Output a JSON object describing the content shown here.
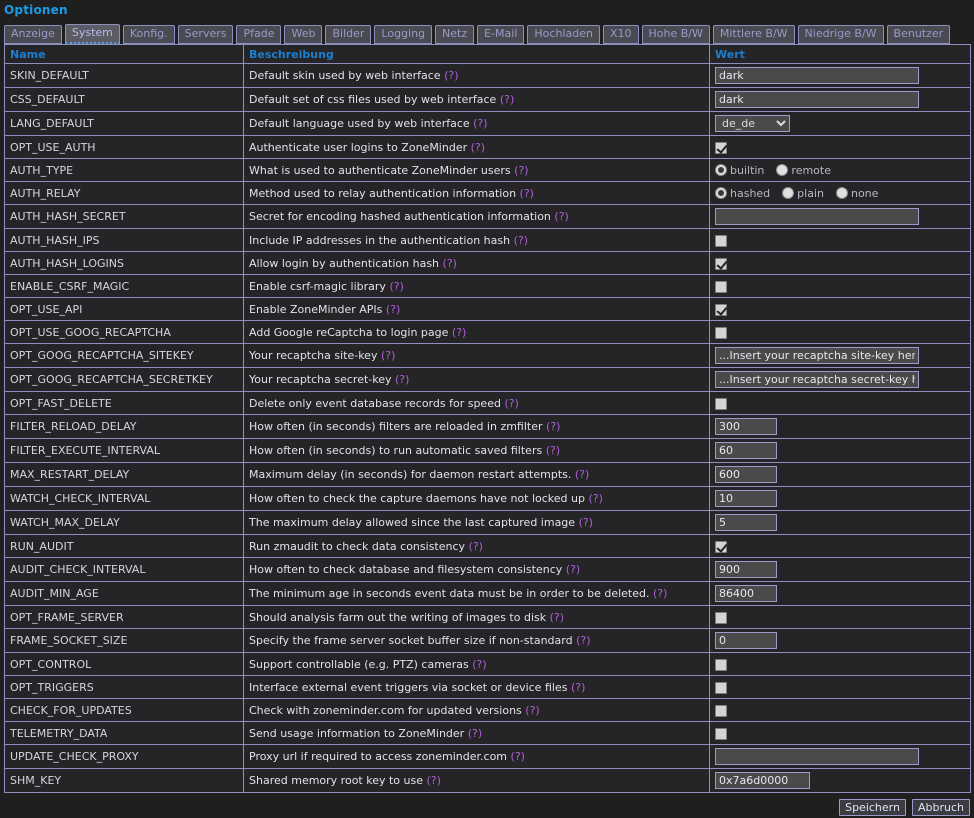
{
  "page": {
    "title": "Optionen"
  },
  "tabs": [
    {
      "label": "Anzeige",
      "active": false
    },
    {
      "label": "System",
      "active": true
    },
    {
      "label": "Konfig.",
      "active": false
    },
    {
      "label": "Servers",
      "active": false
    },
    {
      "label": "Pfade",
      "active": false
    },
    {
      "label": "Web",
      "active": false
    },
    {
      "label": "Bilder",
      "active": false
    },
    {
      "label": "Logging",
      "active": false
    },
    {
      "label": "Netz",
      "active": false
    },
    {
      "label": "E-Mail",
      "active": false
    },
    {
      "label": "Hochladen",
      "active": false
    },
    {
      "label": "X10",
      "active": false
    },
    {
      "label": "Hohe B/W",
      "active": false
    },
    {
      "label": "Mittlere B/W",
      "active": false
    },
    {
      "label": "Niedrige B/W",
      "active": false
    },
    {
      "label": "Benutzer",
      "active": false
    }
  ],
  "table": {
    "headers": {
      "name": "Name",
      "description": "Beschreibung",
      "value": "Wert"
    },
    "help_marker": "(?)",
    "rows": [
      {
        "name": "SKIN_DEFAULT",
        "desc": "Default skin used by web interface",
        "type": "text",
        "value": "dark",
        "width": "wide"
      },
      {
        "name": "CSS_DEFAULT",
        "desc": "Default set of css files used by web interface",
        "type": "text",
        "value": "dark",
        "width": "wide"
      },
      {
        "name": "LANG_DEFAULT",
        "desc": "Default language used by web interface",
        "type": "select",
        "value": "de_de",
        "options": [
          "de_de"
        ]
      },
      {
        "name": "OPT_USE_AUTH",
        "desc": "Authenticate user logins to ZoneMinder",
        "type": "checkbox",
        "checked": true
      },
      {
        "name": "AUTH_TYPE",
        "desc": "What is used to authenticate ZoneMinder users",
        "type": "radio",
        "selected": "builtin",
        "options": [
          "builtin",
          "remote"
        ]
      },
      {
        "name": "AUTH_RELAY",
        "desc": "Method used to relay authentication information",
        "type": "radio",
        "selected": "hashed",
        "options": [
          "hashed",
          "plain",
          "none"
        ]
      },
      {
        "name": "AUTH_HASH_SECRET",
        "desc": "Secret for encoding hashed authentication information",
        "type": "text",
        "value": "",
        "width": "wide"
      },
      {
        "name": "AUTH_HASH_IPS",
        "desc": "Include IP addresses in the authentication hash",
        "type": "checkbox",
        "checked": false
      },
      {
        "name": "AUTH_HASH_LOGINS",
        "desc": "Allow login by authentication hash",
        "type": "checkbox",
        "checked": true
      },
      {
        "name": "ENABLE_CSRF_MAGIC",
        "desc": "Enable csrf-magic library",
        "type": "checkbox",
        "checked": false
      },
      {
        "name": "OPT_USE_API",
        "desc": "Enable ZoneMinder APIs",
        "type": "checkbox",
        "checked": true
      },
      {
        "name": "OPT_USE_GOOG_RECAPTCHA",
        "desc": "Add Google reCaptcha to login page",
        "type": "checkbox",
        "checked": false
      },
      {
        "name": "OPT_GOOG_RECAPTCHA_SITEKEY",
        "desc": "Your recaptcha site-key",
        "type": "text",
        "value": "...Insert your recaptcha site-key here...",
        "width": "wide"
      },
      {
        "name": "OPT_GOOG_RECAPTCHA_SECRETKEY",
        "desc": "Your recaptcha secret-key",
        "type": "text",
        "value": "...Insert your recaptcha secret-key here...",
        "width": "wide"
      },
      {
        "name": "OPT_FAST_DELETE",
        "desc": "Delete only event database records for speed",
        "type": "checkbox",
        "checked": false
      },
      {
        "name": "FILTER_RELOAD_DELAY",
        "desc": "How often (in seconds) filters are reloaded in zmfilter",
        "type": "text",
        "value": "300",
        "width": "small"
      },
      {
        "name": "FILTER_EXECUTE_INTERVAL",
        "desc": "How often (in seconds) to run automatic saved filters",
        "type": "text",
        "value": "60",
        "width": "small"
      },
      {
        "name": "MAX_RESTART_DELAY",
        "desc": "Maximum delay (in seconds) for daemon restart attempts.",
        "type": "text",
        "value": "600",
        "width": "small"
      },
      {
        "name": "WATCH_CHECK_INTERVAL",
        "desc": "How often to check the capture daemons have not locked up",
        "type": "text",
        "value": "10",
        "width": "small"
      },
      {
        "name": "WATCH_MAX_DELAY",
        "desc": "The maximum delay allowed since the last captured image",
        "type": "text",
        "value": "5",
        "width": "small"
      },
      {
        "name": "RUN_AUDIT",
        "desc": "Run zmaudit to check data consistency",
        "type": "checkbox",
        "checked": true
      },
      {
        "name": "AUDIT_CHECK_INTERVAL",
        "desc": "How often to check database and filesystem consistency",
        "type": "text",
        "value": "900",
        "width": "small"
      },
      {
        "name": "AUDIT_MIN_AGE",
        "desc": "The minimum age in seconds event data must be in order to be deleted.",
        "type": "text",
        "value": "86400",
        "width": "small"
      },
      {
        "name": "OPT_FRAME_SERVER",
        "desc": "Should analysis farm out the writing of images to disk",
        "type": "checkbox",
        "checked": false
      },
      {
        "name": "FRAME_SOCKET_SIZE",
        "desc": "Specify the frame server socket buffer size if non-standard",
        "type": "text",
        "value": "0",
        "width": "small"
      },
      {
        "name": "OPT_CONTROL",
        "desc": "Support controllable (e.g. PTZ) cameras",
        "type": "checkbox",
        "checked": false
      },
      {
        "name": "OPT_TRIGGERS",
        "desc": "Interface external event triggers via socket or device files",
        "type": "checkbox",
        "checked": false
      },
      {
        "name": "CHECK_FOR_UPDATES",
        "desc": "Check with zoneminder.com for updated versions",
        "type": "checkbox",
        "checked": false
      },
      {
        "name": "TELEMETRY_DATA",
        "desc": "Send usage information to ZoneMinder",
        "type": "checkbox",
        "checked": false
      },
      {
        "name": "UPDATE_CHECK_PROXY",
        "desc": "Proxy url if required to access zoneminder.com",
        "type": "text",
        "value": "",
        "width": "wide"
      },
      {
        "name": "SHM_KEY",
        "desc": "Shared memory root key to use",
        "type": "text",
        "value": "0x7a6d0000",
        "width": "shm"
      }
    ]
  },
  "footer": {
    "save_label": "Speichern",
    "cancel_label": "Abbruch"
  },
  "colors": {
    "background": "#1f1f1f",
    "title": "#1c9ce8",
    "header_text": "#1c7fd0",
    "border": "#8f8fbf",
    "help_link": "#b05fd8",
    "input_bg": "#4a4a4a"
  }
}
